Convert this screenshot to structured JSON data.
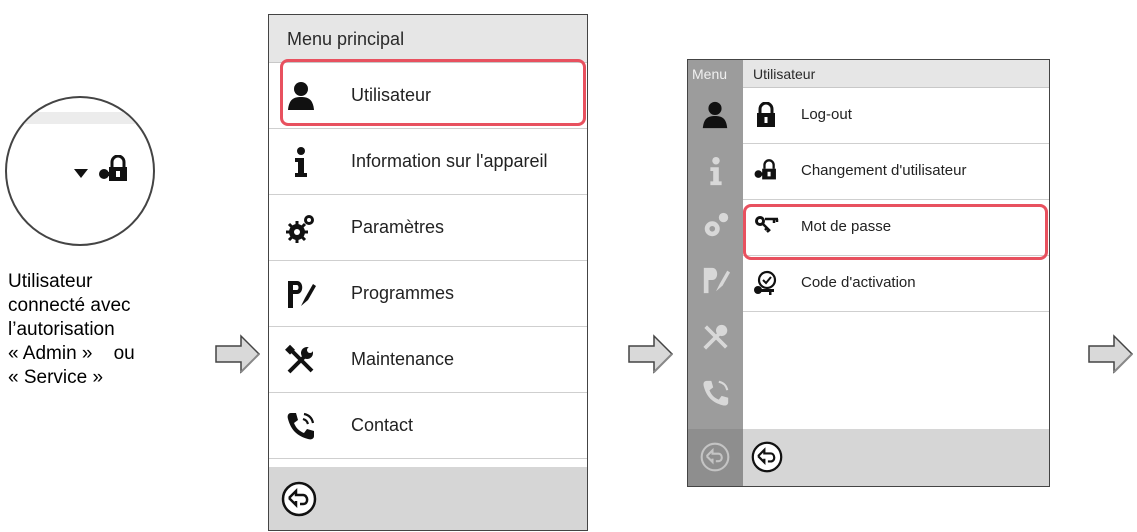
{
  "zoom": {
    "icons": [
      "dropdown-triangle-icon",
      "user-login-lock-icon"
    ],
    "caption_lines": [
      "Utilisateur",
      "connecté avec",
      "l’autorisation",
      "« Admin »    ou",
      "« Service »"
    ]
  },
  "main_menu": {
    "title": "Menu principal",
    "items": [
      {
        "label": "Utilisateur",
        "icon": "user-icon",
        "highlighted": true
      },
      {
        "label": "Information sur l'appareil",
        "icon": "info-icon"
      },
      {
        "label": "Paramètres",
        "icon": "settings-gears-icon"
      },
      {
        "label": "Programmes",
        "icon": "programs-icon"
      },
      {
        "label": "Maintenance",
        "icon": "maintenance-tools-icon"
      },
      {
        "label": "Contact",
        "icon": "phone-contact-icon"
      }
    ],
    "back_icon": "back-arrow-icon"
  },
  "user_menu": {
    "sidebar_label": "Menu",
    "title": "Utilisateur",
    "items": [
      {
        "label": "Log-out",
        "icon": "lock-icon"
      },
      {
        "label": "Changement d'utilisateur",
        "icon": "user-change-lock-icon"
      },
      {
        "label": "Mot de passe",
        "icon": "keys-icon",
        "highlighted": true
      },
      {
        "label": "Code d'activation",
        "icon": "activation-code-icon"
      }
    ],
    "sidebar_icons": [
      "user-icon",
      "info-icon",
      "settings-gears-icon",
      "programs-icon",
      "maintenance-tools-icon",
      "phone-contact-icon",
      "back-arrow-icon"
    ]
  },
  "colors": {
    "highlight": "#e8515f",
    "sidebar": "#9c9c9c",
    "header": "#e6e6e6",
    "footer": "#d6d6d6"
  }
}
